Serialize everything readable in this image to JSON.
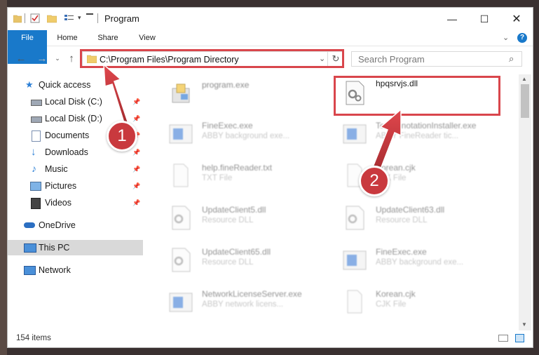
{
  "window": {
    "title": "Program"
  },
  "ribbon": {
    "tabs": [
      "File",
      "Home",
      "Share",
      "View"
    ]
  },
  "address": {
    "path": "C:\\Program Files\\Program Directory"
  },
  "search": {
    "placeholder": "Search Program"
  },
  "nav": {
    "quick_access": "Quick access",
    "items": [
      "Local Disk (C:)",
      "Local Disk (D:)",
      "Documents",
      "Downloads",
      "Music",
      "Pictures",
      "Videos"
    ],
    "onedrive": "OneDrive",
    "this_pc": "This PC",
    "network": "Network"
  },
  "files": [
    {
      "name": "program.exe",
      "desc": "",
      "icon": "exe-installer-icon"
    },
    {
      "name": "hpqsrvjs.dll",
      "desc": "",
      "icon": "dll-gear-icon"
    },
    {
      "name": "FineExec.exe",
      "desc": "ABBY background exe...",
      "icon": "app-window-icon"
    },
    {
      "name": "TextAnnotationInstaller.exe",
      "desc": "ABBY FineReader tic...",
      "icon": "app-window-icon"
    },
    {
      "name": "help.fineReader.txt",
      "desc": "TXT File",
      "icon": "text-file-icon"
    },
    {
      "name": "Korean.cjk",
      "desc": "CJK File",
      "icon": "text-file-icon"
    },
    {
      "name": "UpdateClient5.dll",
      "desc": "Resource DLL",
      "icon": "dll-gear-icon"
    },
    {
      "name": "UpdateClient63.dll",
      "desc": "Resource DLL",
      "icon": "dll-gear-icon"
    },
    {
      "name": "UpdateClient65.dll",
      "desc": "Resource DLL",
      "icon": "dll-gear-icon"
    },
    {
      "name": "FineExec.exe",
      "desc": "ABBY background exe...",
      "icon": "app-window-icon"
    },
    {
      "name": "NetworkLicenseServer.exe",
      "desc": "ABBY network licens...",
      "icon": "app-window-icon"
    },
    {
      "name": "Korean.cjk",
      "desc": "CJK File",
      "icon": "text-file-icon"
    }
  ],
  "status": {
    "count": "154 items"
  },
  "annotations": {
    "step1": "1",
    "step2": "2"
  },
  "colors": {
    "accent": "#1979ca",
    "highlight": "#d9464c",
    "selection": "#d9d9d9"
  }
}
